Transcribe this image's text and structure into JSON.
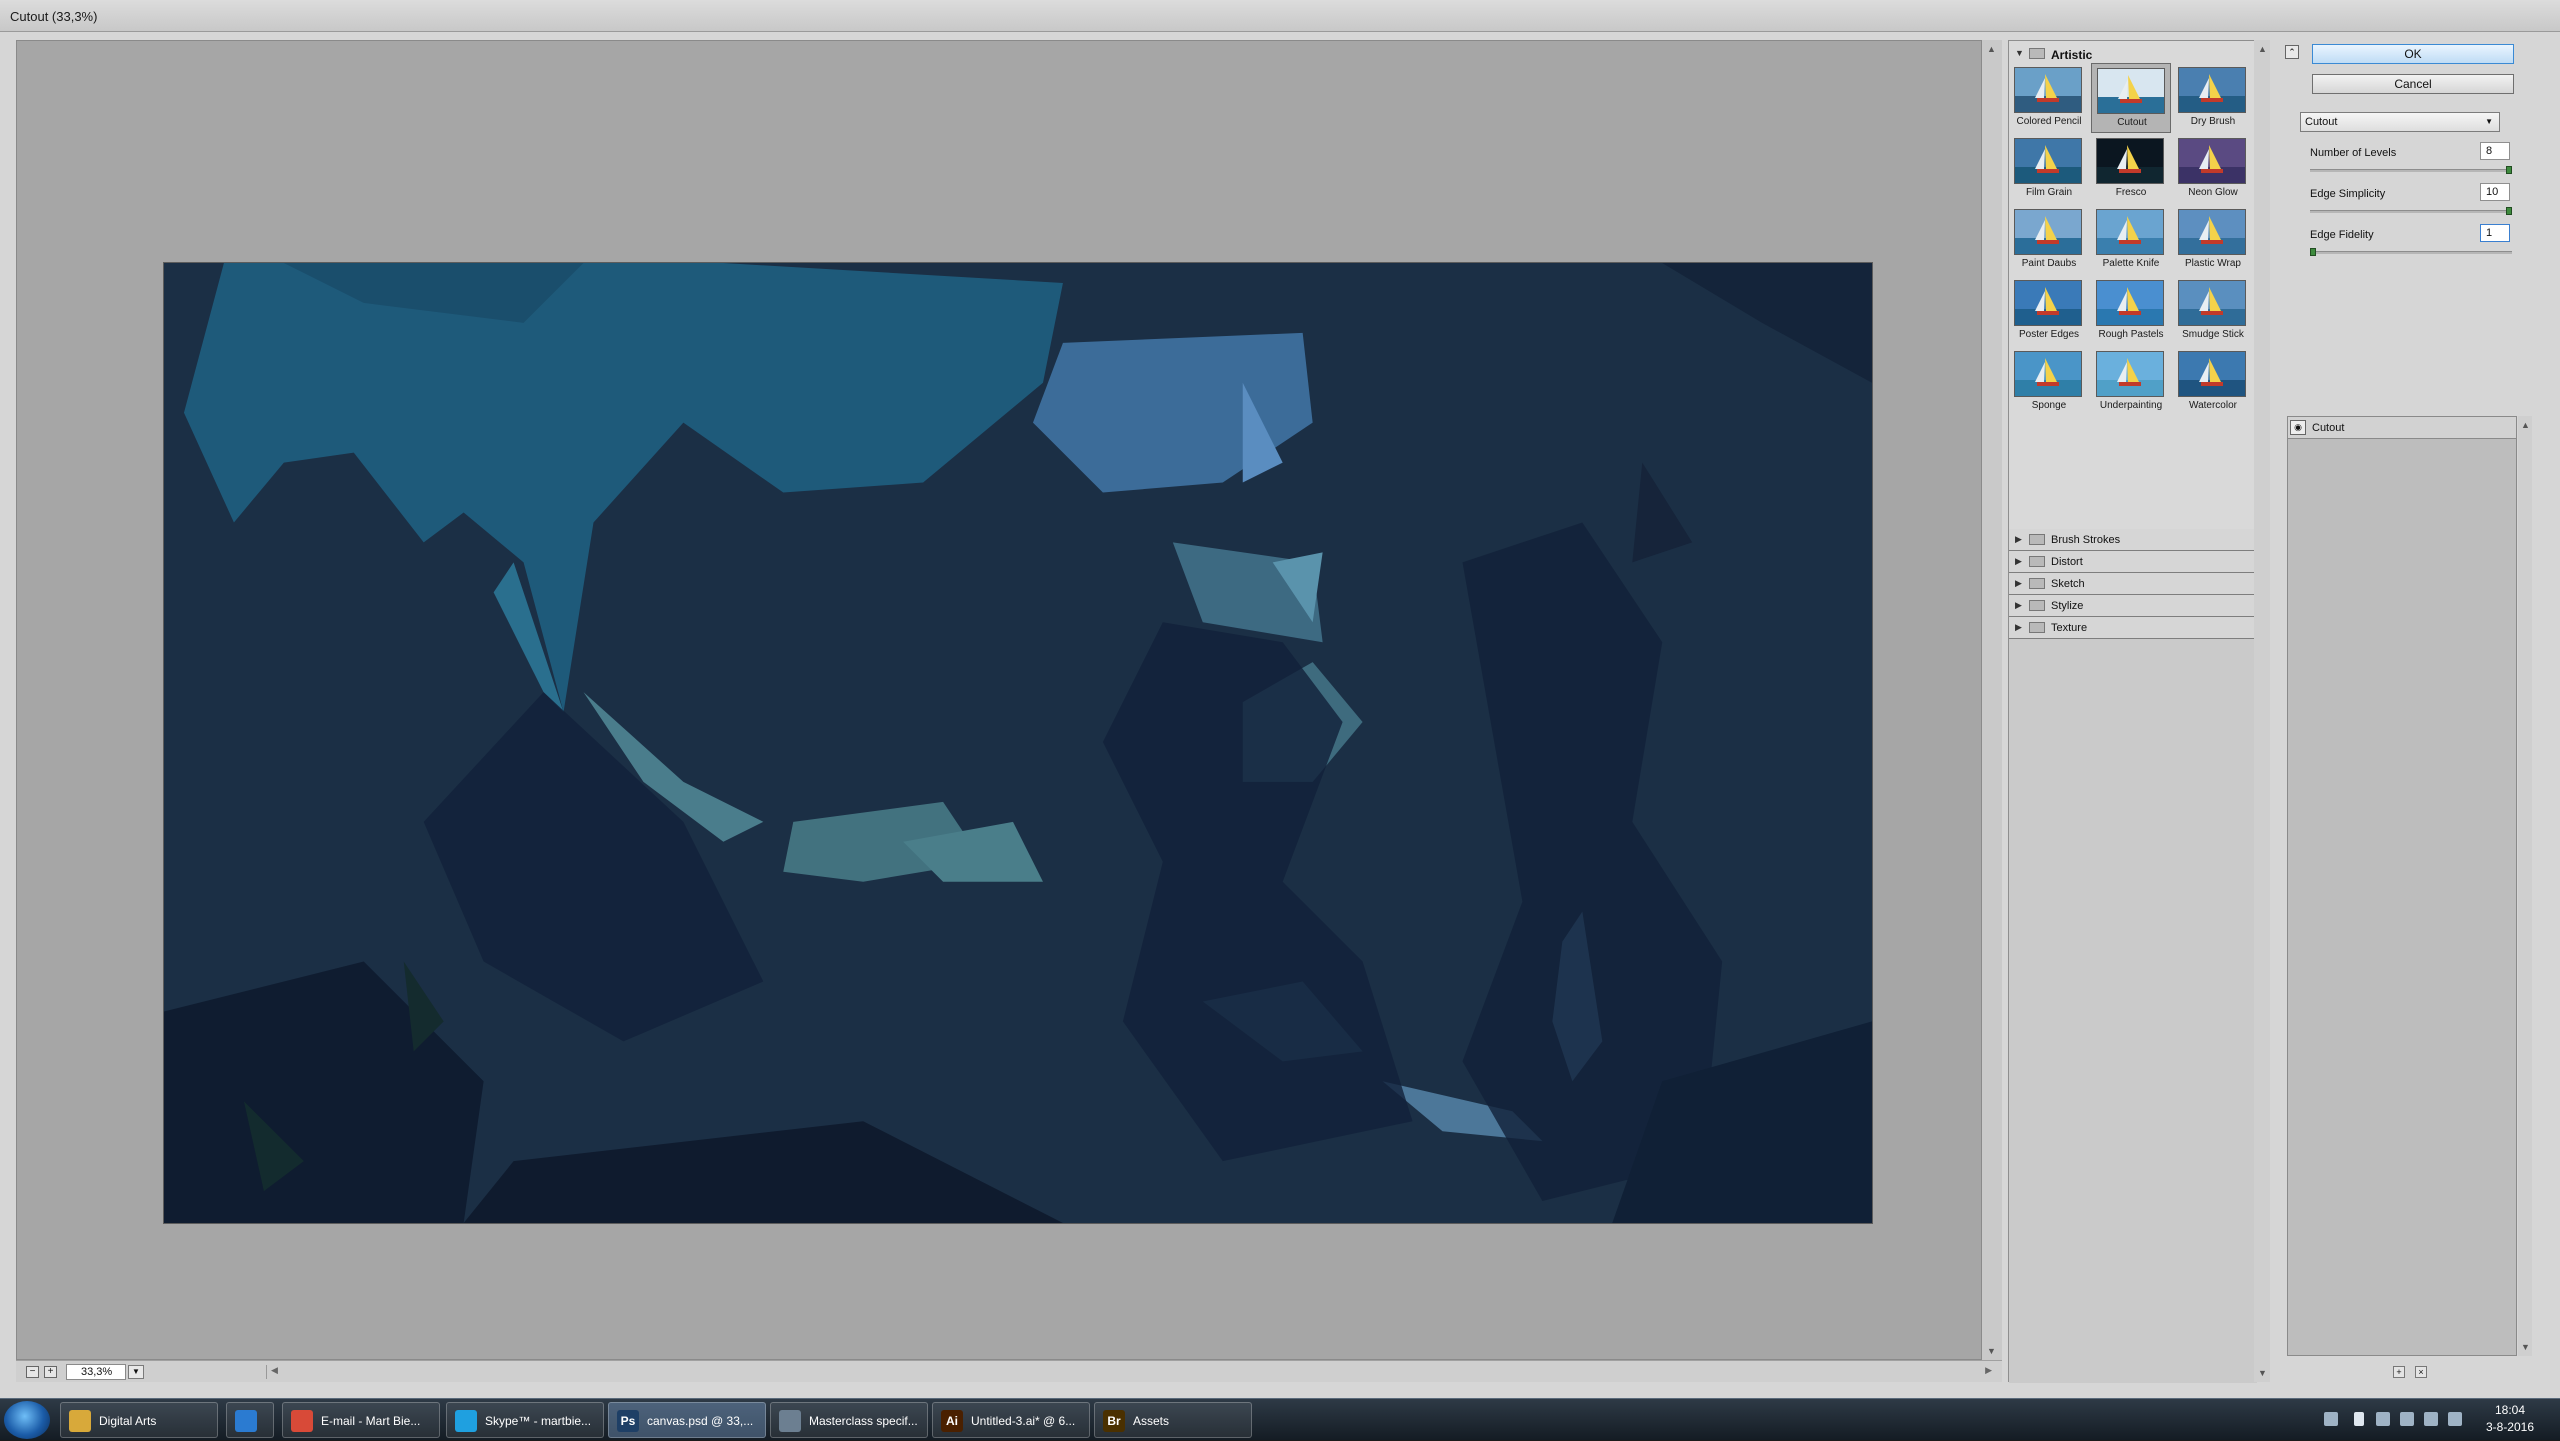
{
  "window": {
    "title": "Cutout (33,3%)"
  },
  "zoom": {
    "value": "33,3%"
  },
  "gallery": {
    "artistic_label": "Artistic",
    "filters": [
      {
        "label": "Colored Pencil"
      },
      {
        "label": "Cutout"
      },
      {
        "label": "Dry Brush"
      },
      {
        "label": "Film Grain"
      },
      {
        "label": "Fresco"
      },
      {
        "label": "Neon Glow"
      },
      {
        "label": "Paint Daubs"
      },
      {
        "label": "Palette Knife"
      },
      {
        "label": "Plastic Wrap"
      },
      {
        "label": "Poster Edges"
      },
      {
        "label": "Rough Pastels"
      },
      {
        "label": "Smudge Stick"
      },
      {
        "label": "Sponge"
      },
      {
        "label": "Underpainting"
      },
      {
        "label": "Watercolor"
      }
    ],
    "selected_filter": "Cutout",
    "categories": [
      {
        "label": "Brush Strokes"
      },
      {
        "label": "Distort"
      },
      {
        "label": "Sketch"
      },
      {
        "label": "Stylize"
      },
      {
        "label": "Texture"
      }
    ]
  },
  "buttons": {
    "ok": "OK",
    "cancel": "Cancel"
  },
  "settings": {
    "filter_select": "Cutout",
    "params": [
      {
        "label": "Number of Levels",
        "value": "8",
        "level_fraction": 1.0
      },
      {
        "label": "Edge Simplicity",
        "value": "10",
        "level_fraction": 1.0
      },
      {
        "label": "Edge Fidelity",
        "value": "1",
        "level_fraction": 0.0
      }
    ]
  },
  "layers": {
    "items": [
      {
        "label": "Cutout"
      }
    ]
  },
  "taskbar": {
    "items": [
      {
        "label": "Digital Arts",
        "icon": "folder-icon",
        "color": "#d8a93a"
      },
      {
        "label": "",
        "icon": "ccleaner-icon",
        "color": "#2b7bd1"
      },
      {
        "label": "E-mail - Mart Bie...",
        "icon": "chrome-icon",
        "color": "#d84a38"
      },
      {
        "label": "Skype™ - martbie...",
        "icon": "skype-icon",
        "color": "#1fa0e0"
      },
      {
        "label": "canvas.psd @ 33,...",
        "icon": "photoshop-icon",
        "color": "#1e3f66"
      },
      {
        "label": "Masterclass specif...",
        "icon": "document-icon",
        "color": "#6c7f91"
      },
      {
        "label": "Untitled-3.ai* @ 6...",
        "icon": "illustrator-icon",
        "color": "#4a2000"
      },
      {
        "label": "Assets",
        "icon": "bridge-icon",
        "color": "#4a3000"
      }
    ],
    "ps_label": "Ps",
    "ai_label": "Ai",
    "br_label": "Br",
    "clock_time": "18:04",
    "clock_date": "3-8-2016"
  }
}
